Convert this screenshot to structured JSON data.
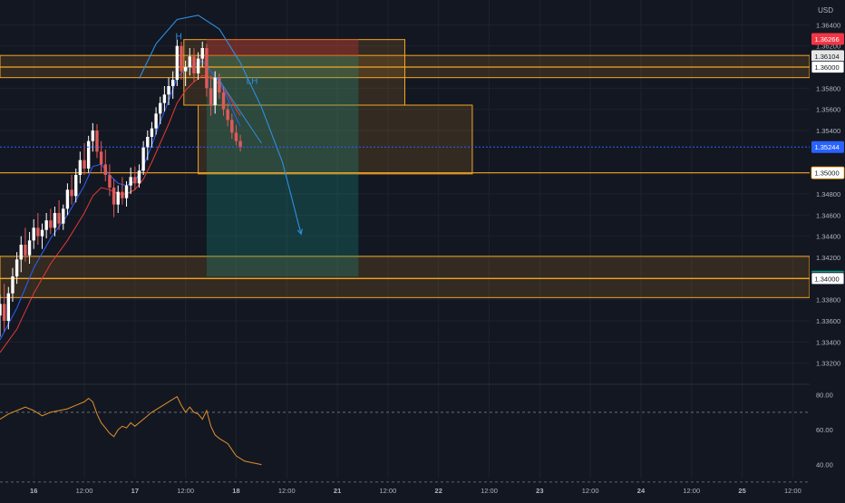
{
  "colors": {
    "background": "#131722",
    "grid": "#1e222d",
    "bull": "#ffffff",
    "bear": "#e05a5a",
    "zone_stroke": "#f5a623",
    "zone_fill": "#f5a62324",
    "level_line": "#f5a623",
    "stop_fill": "#b8323266",
    "target_fill": "#1e9d8a44",
    "ema_fast": "#2962ff",
    "ema_slow": "#e53935",
    "forecast_arc": "#2f8fe0",
    "rsi_line": "#e0902a",
    "axis_text": "#b2b5be",
    "current_price_tag": "#2962ff",
    "stop_tag": "#f23645",
    "target_tag": "#089981"
  },
  "chart_data": {
    "type": "candlestick",
    "symbol_currency": "USD",
    "price_axis": {
      "ylim": [
        1.33,
        1.366
      ],
      "tick_labels": [
        "1.36400",
        "1.36200",
        "1.35800",
        "1.35600",
        "1.35400",
        "1.34800",
        "1.34600",
        "1.34400",
        "1.34200",
        "1.33800",
        "1.33600",
        "1.33400",
        "1.33200"
      ],
      "tick_values": [
        1.364,
        1.362,
        1.358,
        1.356,
        1.354,
        1.348,
        1.346,
        1.344,
        1.342,
        1.338,
        1.336,
        1.334,
        1.332
      ]
    },
    "price_tags": [
      {
        "label": "1.36266",
        "value": 1.36266,
        "kind": "stop"
      },
      {
        "label": "1.36104",
        "value": 1.36104,
        "kind": "entry"
      },
      {
        "label": "1.36000",
        "value": 1.36,
        "kind": "level"
      },
      {
        "label": "1.35244",
        "value": 1.35244,
        "kind": "current"
      },
      {
        "label": "1.35000",
        "value": 1.35,
        "kind": "level_orange"
      },
      {
        "label": "1.34018",
        "value": 1.34018,
        "kind": "target"
      },
      {
        "label": "1.34000",
        "value": 1.34,
        "kind": "level"
      }
    ],
    "time_axis": {
      "xlim": [
        0,
        96
      ],
      "ticks": [
        {
          "t": 4,
          "label": "16",
          "bold": true
        },
        {
          "t": 10,
          "label": "12:00",
          "bold": false
        },
        {
          "t": 16,
          "label": "17",
          "bold": true
        },
        {
          "t": 22,
          "label": "12:00",
          "bold": false
        },
        {
          "t": 28,
          "label": "18",
          "bold": true
        },
        {
          "t": 34,
          "label": "12:00",
          "bold": false
        },
        {
          "t": 40,
          "label": "21",
          "bold": true
        },
        {
          "t": 46,
          "label": "12:00",
          "bold": false
        },
        {
          "t": 52,
          "label": "22",
          "bold": true
        },
        {
          "t": 58,
          "label": "12:00",
          "bold": false
        },
        {
          "t": 64,
          "label": "23",
          "bold": true
        },
        {
          "t": 70,
          "label": "12:00",
          "bold": false
        },
        {
          "t": 76,
          "label": "24",
          "bold": true
        },
        {
          "t": 82,
          "label": "12:00",
          "bold": false
        },
        {
          "t": 88,
          "label": "25",
          "bold": true
        },
        {
          "t": 94,
          "label": "12:00",
          "bold": false
        }
      ]
    },
    "candles": [
      [
        0.0,
        1.3365,
        1.3385,
        1.3345,
        1.3376
      ],
      [
        0.5,
        1.3376,
        1.3395,
        1.335,
        1.336
      ],
      [
        1.0,
        1.336,
        1.3392,
        1.3352,
        1.3386
      ],
      [
        1.5,
        1.3386,
        1.341,
        1.3378,
        1.3402
      ],
      [
        2.0,
        1.3402,
        1.3425,
        1.3395,
        1.3418
      ],
      [
        2.5,
        1.3418,
        1.344,
        1.3406,
        1.3432
      ],
      [
        3.0,
        1.3432,
        1.3448,
        1.3416,
        1.3422
      ],
      [
        3.5,
        1.3422,
        1.3444,
        1.3414,
        1.3436
      ],
      [
        4.0,
        1.3436,
        1.3456,
        1.3428,
        1.3448
      ],
      [
        4.5,
        1.3448,
        1.3462,
        1.3432,
        1.344
      ],
      [
        5.0,
        1.344,
        1.3452,
        1.3428,
        1.3446
      ],
      [
        5.5,
        1.3446,
        1.3462,
        1.3438,
        1.3455
      ],
      [
        6.0,
        1.3455,
        1.3466,
        1.3442,
        1.3448
      ],
      [
        6.5,
        1.3448,
        1.3468,
        1.344,
        1.3462
      ],
      [
        7.0,
        1.3462,
        1.3474,
        1.3446,
        1.3452
      ],
      [
        7.5,
        1.3452,
        1.347,
        1.3446,
        1.3466
      ],
      [
        8.0,
        1.3466,
        1.349,
        1.346,
        1.3484
      ],
      [
        8.5,
        1.3484,
        1.3498,
        1.347,
        1.3478
      ],
      [
        9.0,
        1.3478,
        1.3504,
        1.3472,
        1.3498
      ],
      [
        9.5,
        1.3498,
        1.352,
        1.349,
        1.3512
      ],
      [
        10.0,
        1.3512,
        1.3528,
        1.3498,
        1.3504
      ],
      [
        10.5,
        1.3504,
        1.3535,
        1.35,
        1.353
      ],
      [
        11.0,
        1.353,
        1.3547,
        1.352,
        1.354
      ],
      [
        11.5,
        1.354,
        1.3546,
        1.3514,
        1.352
      ],
      [
        12.0,
        1.352,
        1.353,
        1.35,
        1.3508
      ],
      [
        12.5,
        1.3508,
        1.3522,
        1.3492,
        1.3498
      ],
      [
        13.0,
        1.3498,
        1.3508,
        1.3478,
        1.3486
      ],
      [
        13.5,
        1.3486,
        1.3494,
        1.3458,
        1.347
      ],
      [
        14.0,
        1.347,
        1.3488,
        1.3462,
        1.3482
      ],
      [
        14.5,
        1.3482,
        1.3496,
        1.347,
        1.3476
      ],
      [
        15.0,
        1.3476,
        1.3492,
        1.3468,
        1.3488
      ],
      [
        15.5,
        1.3488,
        1.3505,
        1.348,
        1.3496
      ],
      [
        16.0,
        1.3496,
        1.3506,
        1.3484,
        1.349
      ],
      [
        16.5,
        1.349,
        1.3508,
        1.3486,
        1.3502
      ],
      [
        17.0,
        1.3502,
        1.353,
        1.3498,
        1.3524
      ],
      [
        17.5,
        1.3524,
        1.354,
        1.3512,
        1.3534
      ],
      [
        18.0,
        1.3534,
        1.3548,
        1.3524,
        1.3542
      ],
      [
        18.5,
        1.3542,
        1.3562,
        1.3536,
        1.3556
      ],
      [
        19.0,
        1.3556,
        1.3572,
        1.3546,
        1.3566
      ],
      [
        19.5,
        1.3566,
        1.3582,
        1.3558,
        1.3574
      ],
      [
        20.0,
        1.3574,
        1.359,
        1.3564,
        1.3582
      ],
      [
        20.5,
        1.3582,
        1.3596,
        1.357,
        1.3588
      ],
      [
        21.0,
        1.3588,
        1.3626,
        1.3582,
        1.362
      ],
      [
        21.5,
        1.362,
        1.3624,
        1.3588,
        1.3596
      ],
      [
        22.0,
        1.3596,
        1.3606,
        1.3582,
        1.36
      ],
      [
        22.5,
        1.36,
        1.3618,
        1.3592,
        1.361
      ],
      [
        23.0,
        1.361,
        1.3618,
        1.3586,
        1.3594
      ],
      [
        23.5,
        1.3594,
        1.3614,
        1.3588,
        1.3608
      ],
      [
        24.0,
        1.3608,
        1.3624,
        1.36,
        1.3618
      ],
      [
        24.5,
        1.3618,
        1.3622,
        1.3572,
        1.358
      ],
      [
        25.0,
        1.358,
        1.3592,
        1.3554,
        1.3564
      ],
      [
        25.5,
        1.3564,
        1.3596,
        1.3556,
        1.359
      ],
      [
        26.0,
        1.359,
        1.3594,
        1.357,
        1.3576
      ],
      [
        26.5,
        1.3576,
        1.3582,
        1.3554,
        1.356
      ],
      [
        27.0,
        1.356,
        1.3566,
        1.3544,
        1.355
      ],
      [
        27.5,
        1.355,
        1.3556,
        1.3532,
        1.3538
      ],
      [
        28.0,
        1.3538,
        1.3545,
        1.3526,
        1.353
      ],
      [
        28.5,
        1.353,
        1.3536,
        1.352,
        1.3524
      ]
    ],
    "ema_fast": [
      [
        0,
        1.3342
      ],
      [
        2,
        1.3372
      ],
      [
        4,
        1.341
      ],
      [
        6,
        1.3438
      ],
      [
        8,
        1.346
      ],
      [
        10,
        1.3488
      ],
      [
        11,
        1.3506
      ],
      [
        12,
        1.3508
      ],
      [
        13,
        1.3498
      ],
      [
        14,
        1.349
      ],
      [
        15,
        1.3488
      ],
      [
        16,
        1.3492
      ],
      [
        17,
        1.3506
      ],
      [
        18,
        1.3526
      ],
      [
        19,
        1.3548
      ],
      [
        20,
        1.3568
      ],
      [
        21,
        1.359
      ],
      [
        22,
        1.3598
      ],
      [
        23,
        1.3602
      ],
      [
        24,
        1.3606
      ],
      [
        25,
        1.3596
      ],
      [
        26,
        1.3586
      ],
      [
        27,
        1.357
      ],
      [
        28,
        1.3552
      ],
      [
        28.5,
        1.3544
      ]
    ],
    "ema_slow": [
      [
        0,
        1.333
      ],
      [
        2,
        1.3352
      ],
      [
        4,
        1.3386
      ],
      [
        6,
        1.3414
      ],
      [
        8,
        1.3436
      ],
      [
        10,
        1.3462
      ],
      [
        11,
        1.3478
      ],
      [
        12,
        1.3486
      ],
      [
        13,
        1.3484
      ],
      [
        14,
        1.348
      ],
      [
        15,
        1.348
      ],
      [
        16,
        1.3484
      ],
      [
        17,
        1.3494
      ],
      [
        18,
        1.351
      ],
      [
        19,
        1.3528
      ],
      [
        20,
        1.3546
      ],
      [
        21,
        1.3566
      ],
      [
        22,
        1.3578
      ],
      [
        23,
        1.3586
      ],
      [
        24,
        1.3592
      ],
      [
        25,
        1.359
      ],
      [
        26,
        1.3584
      ],
      [
        27,
        1.3574
      ],
      [
        28,
        1.356
      ],
      [
        28.5,
        1.3554
      ]
    ],
    "zones": [
      {
        "t0": 0,
        "t1": 96,
        "y0": 1.359,
        "y1": 1.3611,
        "kind": "band"
      },
      {
        "t0": 0,
        "t1": 96,
        "y0": 1.34,
        "y1": 1.3421,
        "kind": "band"
      },
      {
        "t0": 0,
        "t1": 96,
        "y0": 1.3382,
        "y1": 1.34,
        "kind": "band"
      },
      {
        "t0": 21.8,
        "t1": 48,
        "y0": 1.3564,
        "y1": 1.3626,
        "kind": "box"
      },
      {
        "t0": 23.5,
        "t1": 56,
        "y0": 1.3499,
        "y1": 1.3564,
        "kind": "box"
      }
    ],
    "levels": [
      {
        "t0": 0,
        "t1": 96,
        "y": 1.36
      },
      {
        "t0": 0,
        "t1": 96,
        "y": 1.35
      },
      {
        "t0": 0,
        "t1": 96,
        "y": 1.34
      }
    ],
    "position": {
      "t0": 24.5,
      "t1": 42.5,
      "entry": 1.36104,
      "stop": 1.36266,
      "target": 1.34018
    },
    "current_price": 1.35244,
    "forecast_arc": [
      [
        16.5,
        1.3589
      ],
      [
        18.5,
        1.3622
      ],
      [
        21,
        1.3645
      ],
      [
        23.5,
        1.3649
      ],
      [
        26,
        1.3636
      ],
      [
        28.5,
        1.3604
      ],
      [
        31,
        1.3562
      ],
      [
        33.5,
        1.351
      ],
      [
        35.7,
        1.3442
      ]
    ],
    "trendline": [
      [
        25.8,
        1.359
      ],
      [
        31,
        1.3528
      ]
    ],
    "annotations": [
      {
        "text": "H",
        "t": 20.8,
        "y": 1.3626
      },
      {
        "text": "LH",
        "t": 29.2,
        "y": 1.3584
      }
    ],
    "rsi": {
      "tick_labels": [
        "80.00",
        "60.00",
        "40.00"
      ],
      "tick_values": [
        80,
        60,
        40
      ],
      "ylim": [
        32,
        84
      ],
      "levels": [
        70,
        30
      ],
      "values": [
        [
          0,
          66
        ],
        [
          1,
          69
        ],
        [
          2,
          71
        ],
        [
          3,
          73
        ],
        [
          4,
          71
        ],
        [
          5,
          68
        ],
        [
          6,
          70
        ],
        [
          7,
          71
        ],
        [
          8,
          72
        ],
        [
          9,
          74
        ],
        [
          10,
          76
        ],
        [
          10.5,
          78
        ],
        [
          11,
          76
        ],
        [
          11.5,
          69
        ],
        [
          12,
          64
        ],
        [
          12.5,
          61
        ],
        [
          13,
          58
        ],
        [
          13.5,
          56
        ],
        [
          14,
          60
        ],
        [
          14.5,
          62
        ],
        [
          15,
          61
        ],
        [
          15.5,
          64
        ],
        [
          16,
          62
        ],
        [
          17,
          66
        ],
        [
          18,
          70
        ],
        [
          19,
          73
        ],
        [
          20,
          76
        ],
        [
          21,
          79
        ],
        [
          21.5,
          74
        ],
        [
          22,
          70
        ],
        [
          22.5,
          73
        ],
        [
          23,
          70
        ],
        [
          23.5,
          69
        ],
        [
          24,
          66
        ],
        [
          24.5,
          71
        ],
        [
          25,
          62
        ],
        [
          25.5,
          57
        ],
        [
          26,
          55
        ],
        [
          27,
          52
        ],
        [
          28,
          45
        ],
        [
          29,
          42
        ],
        [
          30,
          41
        ],
        [
          31,
          40
        ]
      ]
    }
  }
}
